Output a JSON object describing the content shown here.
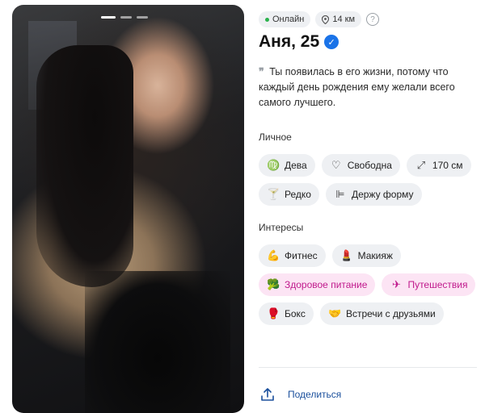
{
  "photo": {
    "progress_total": 3,
    "progress_active": 1
  },
  "status": {
    "online": "Онлайн",
    "distance": "14 км",
    "help": "?"
  },
  "profile": {
    "name": "Аня, 25",
    "verified": true
  },
  "quote": {
    "mark": "❞",
    "text": "Ты появилась в его жизни, потому что каждый день рождения ему желали всего самого лучшего."
  },
  "personal": {
    "title": "Личное",
    "chips": [
      {
        "icon": "virgo-icon",
        "glyph": "♍",
        "label": "Дева"
      },
      {
        "icon": "heart-icon",
        "glyph": "♡",
        "label": "Свободна"
      },
      {
        "icon": "height-icon",
        "glyph": "⤢",
        "label": "170 см"
      },
      {
        "icon": "glass-icon",
        "glyph": "🍸",
        "label": "Редко"
      },
      {
        "icon": "dumbbell-icon",
        "glyph": "⊫",
        "label": "Держу форму"
      }
    ]
  },
  "interests": {
    "title": "Интересы",
    "chips": [
      {
        "icon": "muscle-icon",
        "glyph": "💪",
        "label": "Фитнес",
        "highlight": false
      },
      {
        "icon": "lipstick-icon",
        "glyph": "💄",
        "label": "Макияж",
        "highlight": false
      },
      {
        "icon": "broccoli-icon",
        "glyph": "🥦",
        "label": "Здоровое питание",
        "highlight": true
      },
      {
        "icon": "airplane-icon",
        "glyph": "✈",
        "label": "Путешествия",
        "highlight": true
      },
      {
        "icon": "boxing-glove-icon",
        "glyph": "🥊",
        "label": "Бокс",
        "highlight": false
      },
      {
        "icon": "handshake-icon",
        "glyph": "🤝",
        "label": "Встречи с друзьями",
        "highlight": false
      }
    ]
  },
  "share": {
    "label": "Поделиться"
  },
  "colors": {
    "accent": "#1a73e8",
    "highlight_bg": "#fce4f4",
    "highlight_text": "#c0198c",
    "online": "#2ab24c"
  }
}
